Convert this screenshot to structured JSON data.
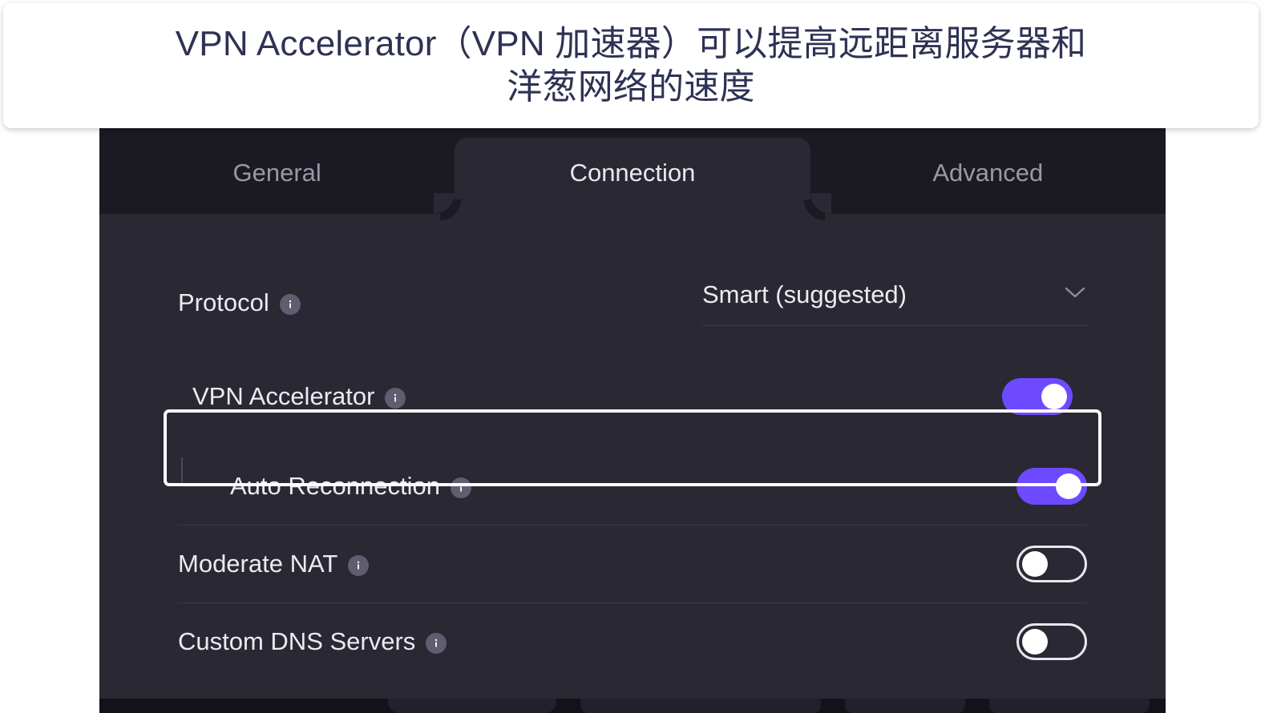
{
  "caption": {
    "text": "VPN Accelerator（VPN 加速器）可以提高远距离服务器和\n洋葱网络的速度"
  },
  "colors": {
    "accent_purple": "#6D4AFF",
    "panel_bg": "#2A2833",
    "tabbar_bg": "#1B1922",
    "highlight_border": "#FFFFFF",
    "caption_text": "#2E3254",
    "label_text": "#ECEAF1",
    "inactive_tab_text": "#9A98A6"
  },
  "tabs": [
    {
      "label": "General",
      "active": false
    },
    {
      "label": "Connection",
      "active": true
    },
    {
      "label": "Advanced",
      "active": false
    }
  ],
  "settings": {
    "protocol": {
      "label": "Protocol",
      "info_icon": "info-icon",
      "value": "Smart (suggested)",
      "chevron_icon": "chevron-down-icon"
    },
    "rows": [
      {
        "label": "VPN Accelerator",
        "info_icon": "info-icon",
        "toggle_state": "on",
        "highlighted": true,
        "sub": false
      },
      {
        "label": "Auto Reconnection",
        "info_icon": "info-icon",
        "toggle_state": "on",
        "highlighted": false,
        "sub": true
      },
      {
        "label": "Moderate NAT",
        "info_icon": "info-icon",
        "toggle_state": "off",
        "highlighted": false,
        "sub": false
      },
      {
        "label": "Custom DNS Servers",
        "info_icon": "info-icon",
        "toggle_state": "off",
        "highlighted": false,
        "sub": false
      }
    ]
  }
}
